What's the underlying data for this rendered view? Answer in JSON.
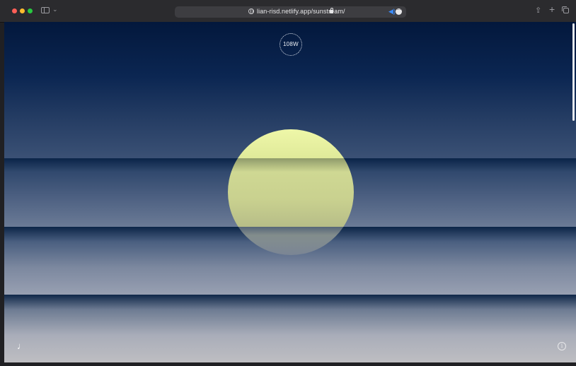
{
  "browser": {
    "url": "lian-risd.netlify.app/sunstream/",
    "icons": {
      "sidebar": "sidebar-icon",
      "secure": "lock-icon",
      "audio": "speaker-icon",
      "more": "ellipsis-icon",
      "share": "share-icon",
      "new_tab": "plus-icon",
      "tab_overview": "tabs-icon"
    }
  },
  "page": {
    "wind_direction": "108W",
    "music_glyph": "♩",
    "info_glyph": "i"
  },
  "colors": {
    "sky_top": "#03183c",
    "horizon": "#bebec2",
    "sun": "#eef7a8"
  }
}
